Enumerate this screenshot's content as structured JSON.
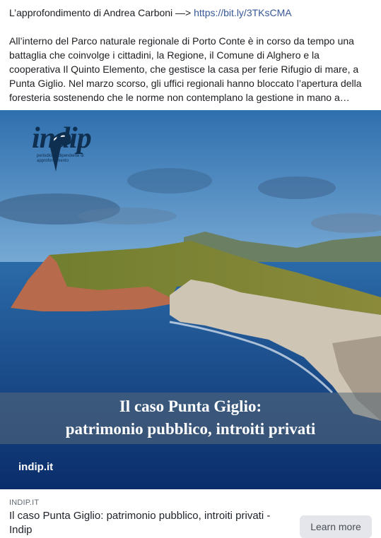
{
  "post": {
    "intro_prefix": "L’approfondimento di Andrea Carboni —> ",
    "intro_link": "https://bit.ly/3TKsCMA",
    "body": "All’interno del Parco naturale regionale di Porto Conte è in corso da tempo una battaglia che coinvolge i cittadini, la Regione, il Comune di Alghero e la cooperativa Il Quinto Elemento, che gestisce la casa per ferie Rifugio di mare, a Punta Giglio. Nel marzo scorso, gli uffici regionali hanno bloccato l’apertura della foresteria sostenendo che le norme non contemplano la gestione in mano a soggetti privati…"
  },
  "image": {
    "logo_word": "indip",
    "logo_subtitle": "periodico indipendente di approfondimento",
    "banner_line1": "Il caso Punta Giglio:",
    "banner_line2": "patrimonio pubblico, introiti privati",
    "watermark": "indip.it"
  },
  "link_preview": {
    "domain": "INDIP.IT",
    "title": "Il caso Punta Giglio: patrimonio pubblico, introiti privati - Indip",
    "button_label": "Learn more"
  },
  "colors": {
    "link": "#385898",
    "button_bg": "#e4e6eb",
    "logo": "#0f2f50"
  }
}
